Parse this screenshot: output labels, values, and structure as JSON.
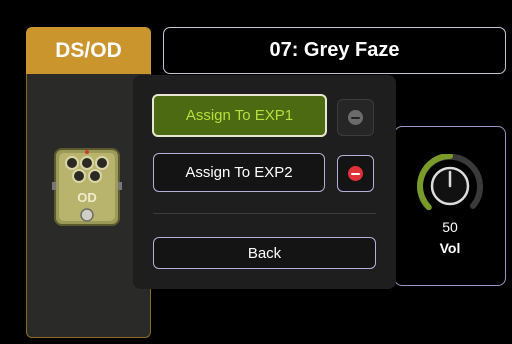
{
  "category": {
    "label": "DS/OD",
    "color": "#c9952c"
  },
  "preset": {
    "title": "07: Grey Faze"
  },
  "knob": {
    "value": "50",
    "label": "Vol",
    "level": 0.5,
    "arc_color": "#7a9a2a"
  },
  "popup": {
    "assign_exp1_label": "Assign To EXP1",
    "assign_exp2_label": "Assign To EXP2",
    "back_label": "Back",
    "remove_exp1_icon": "minus-circle-icon",
    "remove_exp2_icon": "minus-circle-icon",
    "active_color": "#b8e03c",
    "remove_color": "#e0303a"
  },
  "pedal": {
    "icon": "overdrive-pedal-icon",
    "badge": "OD"
  }
}
